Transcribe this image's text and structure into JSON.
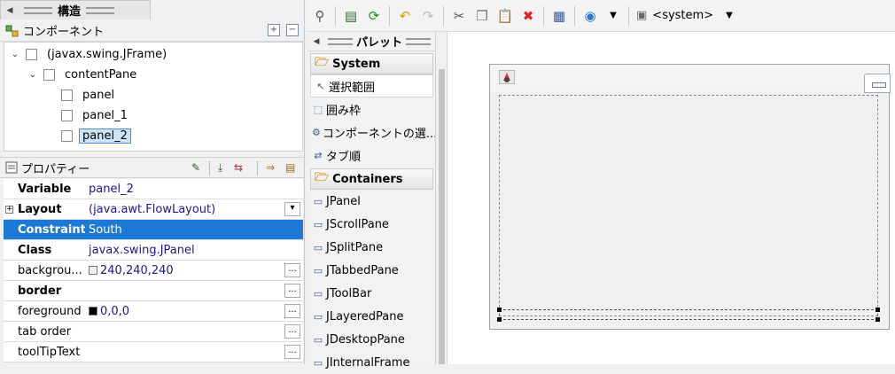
{
  "structure": {
    "tab_title": "構造",
    "components_title": "コンポーネント",
    "tree": [
      {
        "label": "(javax.swing.JFrame)",
        "depth": 0,
        "expanded": true,
        "selected": false
      },
      {
        "label": "contentPane",
        "depth": 1,
        "expanded": true,
        "selected": false
      },
      {
        "label": "panel",
        "depth": 2,
        "selected": false
      },
      {
        "label": "panel_1",
        "depth": 2,
        "selected": false
      },
      {
        "label": "panel_2",
        "depth": 2,
        "selected": true
      }
    ],
    "properties_title": "プロパティー",
    "properties": [
      {
        "name": "Variable",
        "value": "panel_2",
        "bold": true
      },
      {
        "name": "Layout",
        "value": "(java.awt.FlowLayout)",
        "bold": true,
        "expandable": true,
        "button": "▾"
      },
      {
        "name": "Constraints",
        "value": "South",
        "bold": true,
        "selected": true
      },
      {
        "name": "Class",
        "value": "javax.swing.JPanel",
        "bold": true
      },
      {
        "name": "backgrou...",
        "value": "240,240,240",
        "swatch": "#f0f0f0",
        "button": "..."
      },
      {
        "name": "border",
        "value": "",
        "bold": true,
        "button": "..."
      },
      {
        "name": "foreground",
        "value": "0,0,0",
        "swatch": "#000000",
        "button": "..."
      },
      {
        "name": "tab order",
        "value": "",
        "button": "..."
      },
      {
        "name": "toolTipText",
        "value": "",
        "button": "..."
      }
    ]
  },
  "toolbar": {
    "look_and_feel": "<system>"
  },
  "palette": {
    "tab_title": "パレット",
    "categories": [
      {
        "name": "System",
        "items": [
          "選択範囲",
          "囲み枠",
          "コンポーネントの選...",
          "タブ順"
        ]
      },
      {
        "name": "Containers",
        "items": [
          "JPanel",
          "JScrollPane",
          "JSplitPane",
          "JTabbedPane",
          "JToolBar",
          "JLayeredPane",
          "JDesktopPane",
          "JInternalFrame"
        ]
      }
    ]
  },
  "colors": {
    "selection": "#1e78d6",
    "value_text": "#1a1a8c"
  }
}
